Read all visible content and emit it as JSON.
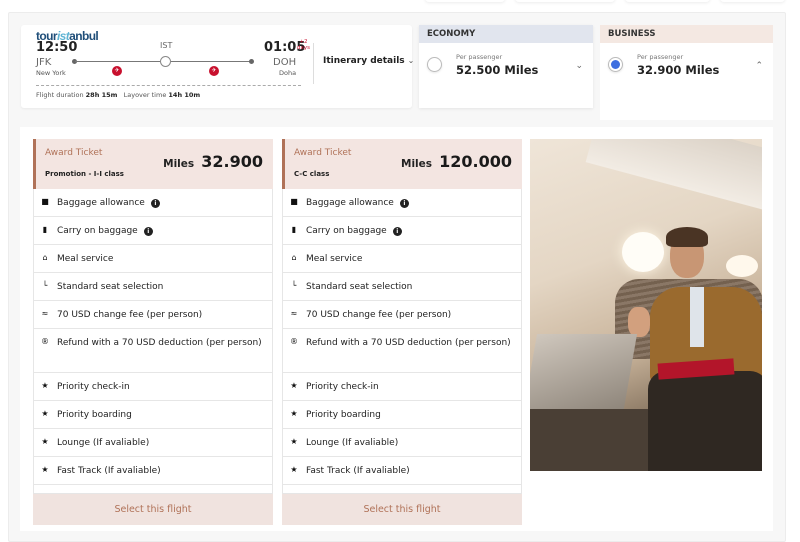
{
  "brand": {
    "logo_part1": "tour",
    "logo_part2": "ist",
    "logo_part3": "anbul"
  },
  "flight": {
    "departure_time": "12:50",
    "departure_code": "JFK",
    "departure_city": "New York",
    "stop_code": "IST",
    "arrival_time": "01:05",
    "arrival_plus": "+2",
    "arrival_plus_unit": "days",
    "arrival_code": "DOH",
    "arrival_city": "Doha",
    "itinerary_label": "Itinerary details",
    "duration_label": "Flight duration",
    "duration_value": "28h 15m",
    "layover_label": "Layover time",
    "layover_value": "14h 10m"
  },
  "fares": {
    "economy": {
      "title": "ECONOMY",
      "per_passenger": "Per passenger",
      "miles": "52.500 Miles",
      "selected": false
    },
    "business": {
      "title": "BUSINESS",
      "per_passenger": "Per passenger",
      "miles": "32.900 Miles",
      "selected": true
    }
  },
  "colors": {
    "accent": "#b07258",
    "selected_radio": "#3e6fe0",
    "airline_red": "#c8102e",
    "economy_header": "#e1e5ee",
    "business_header": "#f4e8e2"
  },
  "tickets": [
    {
      "award_label": "Award Ticket",
      "class_label": "Promotion - I-I class",
      "miles_word": "Miles",
      "miles_value": "32.900",
      "features": [
        {
          "icon": "baggage-icon",
          "label": "Baggage allowance",
          "info": true
        },
        {
          "icon": "carry-on-icon",
          "label": "Carry on baggage",
          "info": true
        },
        {
          "icon": "meal-icon",
          "label": "Meal service",
          "info": false
        },
        {
          "icon": "seat-icon",
          "label": "Standard seat selection",
          "info": false
        },
        {
          "icon": "change-fee-icon",
          "label": "70 USD change fee (per person)",
          "info": false
        },
        {
          "icon": "refund-icon",
          "label": "Refund with a 70 USD deduction (per person)",
          "info": false
        },
        {
          "icon": "star-icon",
          "label": "Priority check-in",
          "info": false
        },
        {
          "icon": "star-icon",
          "label": "Priority boarding",
          "info": false
        },
        {
          "icon": "star-icon",
          "label": "Lounge (If avaliable)",
          "info": false
        },
        {
          "icon": "star-icon",
          "label": "Fast Track (If avaliable)",
          "info": false
        }
      ],
      "select_label": "Select this flight"
    },
    {
      "award_label": "Award Ticket",
      "class_label": "C-C class",
      "miles_word": "Miles",
      "miles_value": "120.000",
      "features": [
        {
          "icon": "baggage-icon",
          "label": "Baggage allowance",
          "info": true
        },
        {
          "icon": "carry-on-icon",
          "label": "Carry on baggage",
          "info": true
        },
        {
          "icon": "meal-icon",
          "label": "Meal service",
          "info": false
        },
        {
          "icon": "seat-icon",
          "label": "Standard seat selection",
          "info": false
        },
        {
          "icon": "change-fee-icon",
          "label": "70 USD change fee (per person)",
          "info": false
        },
        {
          "icon": "refund-icon",
          "label": "Refund with a 70 USD deduction (per person)",
          "info": false
        },
        {
          "icon": "star-icon",
          "label": "Priority check-in",
          "info": false
        },
        {
          "icon": "star-icon",
          "label": "Priority boarding",
          "info": false
        },
        {
          "icon": "star-icon",
          "label": "Lounge (If avaliable)",
          "info": false
        },
        {
          "icon": "star-icon",
          "label": "Fast Track (If avaliable)",
          "info": false
        }
      ],
      "select_label": "Select this flight"
    }
  ],
  "photo": {
    "description": "Business class passenger smiling in cabin seat with laptop"
  }
}
